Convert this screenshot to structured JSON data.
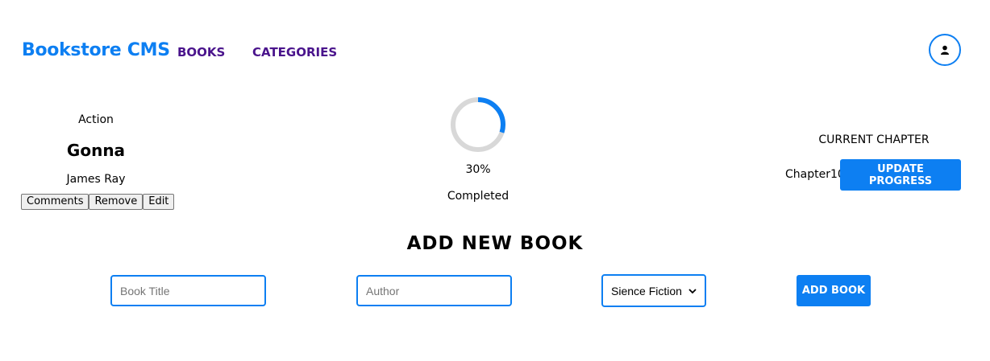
{
  "header": {
    "brand": "Bookstore CMS",
    "nav": [
      {
        "label": "BOOKS"
      },
      {
        "label": "CATEGORIES"
      }
    ],
    "avatar_icon": "user-icon"
  },
  "book": {
    "genre": "Action",
    "title": "Gonna",
    "author": "James Ray",
    "actions": {
      "comments": "Comments",
      "remove": "Remove",
      "edit": "Edit"
    },
    "progress_percent": "30%",
    "progress_fraction": 0.3,
    "completed_label": "Completed",
    "current_chapter_label": "CURRENT CHAPTER",
    "current_chapter": "Chapter10",
    "update_button": "UPDATE PROGRESS"
  },
  "form": {
    "heading": "ADD NEW BOOK",
    "title_placeholder": "Book Title",
    "author_placeholder": "Author",
    "category_selected": "Sience Fiction",
    "submit": "ADD BOOK"
  },
  "colors": {
    "accent": "#0d7ff2",
    "nav": "#4a148c",
    "progress_track": "#d8d8d8"
  }
}
